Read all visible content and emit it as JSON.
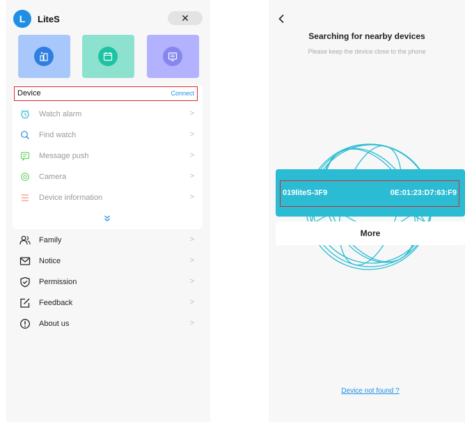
{
  "left": {
    "avatar_letter": "L",
    "app_title": "LiteS",
    "close_symbol": "✕",
    "tiles": [
      {
        "name": "steps-tile",
        "bg": "#a8c8fb",
        "icon_bg": "#2f7fe0",
        "icon": "steps-icon"
      },
      {
        "name": "calendar-tile",
        "bg": "#8de2cf",
        "icon_bg": "#1ec3a3",
        "icon": "calendar-icon"
      },
      {
        "name": "display-tile",
        "bg": "#b3b2ff",
        "icon_bg": "#8786ee",
        "icon": "display-icon"
      }
    ],
    "device": {
      "label": "Device",
      "connect": "Connect",
      "items": [
        {
          "label": "Watch alarm",
          "icon": "alarm-clock-icon",
          "color": "#2bbcd4"
        },
        {
          "label": "Find watch",
          "icon": "search-icon",
          "color": "#1f8fe6"
        },
        {
          "label": "Message push",
          "icon": "message-icon",
          "color": "#6fd26a"
        },
        {
          "label": "Camera",
          "icon": "camera-icon",
          "color": "#6fd26a"
        },
        {
          "label": "Device information",
          "icon": "list-icon",
          "color": "#ff8a7a"
        }
      ]
    },
    "menu": [
      {
        "label": "Family",
        "icon": "family-icon"
      },
      {
        "label": "Notice",
        "icon": "mail-icon"
      },
      {
        "label": "Permission",
        "icon": "shield-icon"
      },
      {
        "label": "Feedback",
        "icon": "edit-icon"
      },
      {
        "label": "About us",
        "icon": "info-icon"
      }
    ],
    "chevron": ">"
  },
  "right": {
    "title": "Searching for nearby devices",
    "subtitle": "Please keep the device close to the phone",
    "device_name": "019liteS-3F9",
    "device_mac": "0E:01:23:D7:63:F9",
    "more_label": "More",
    "not_found": "Device not found ?",
    "accent": "#2bbcd4"
  }
}
